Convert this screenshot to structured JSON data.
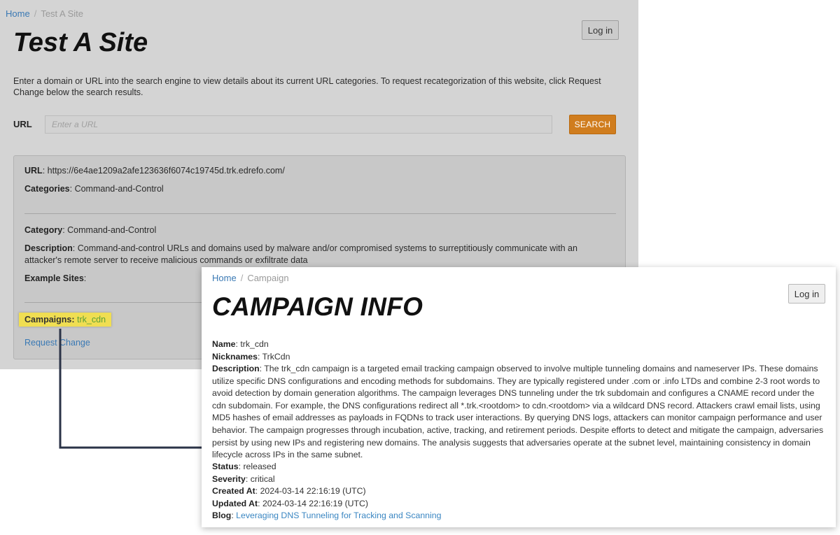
{
  "background_page": {
    "breadcrumb": {
      "home": "Home",
      "separator": "/",
      "current": "Test A Site"
    },
    "login_label": "Log in",
    "title": "Test A Site",
    "intro": "Enter a domain or URL into the search engine to view details about its current URL categories. To request recategorization of this website, click Request Change below the search results.",
    "url_label": "URL",
    "url_placeholder": "Enter a URL",
    "search_label": "SEARCH",
    "result": {
      "url_label": "URL",
      "url_value": "https://6e4ae1209a2afe123636f6074c19745d.trk.edrefo.com/",
      "categories_label": "Categories",
      "categories_value": "Command-and-Control",
      "category_label": "Category",
      "category_value": "Command-and-Control",
      "description_label": "Description",
      "description_value": "Command-and-control URLs and domains used by malware and/or compromised systems to surreptitiously communicate with an attacker's remote server to receive malicious commands or exfiltrate data",
      "example_sites_label": "Example Sites",
      "campaigns_label": "Campaigns",
      "campaigns_value": "trk_cdn",
      "request_change": "Request Change"
    }
  },
  "campaign_page": {
    "breadcrumb": {
      "home": "Home",
      "separator": "/",
      "current": "Campaign"
    },
    "login_label": "Log in",
    "title": "CAMPAIGN INFO",
    "fields": {
      "name_label": "Name",
      "name_value": "trk_cdn",
      "nicknames_label": "Nicknames",
      "nicknames_value": "TrkCdn",
      "description_label": "Description",
      "description_value": "The trk_cdn campaign is a targeted email tracking campaign observed to involve multiple tunneling domains and nameserver IPs. These domains utilize specific DNS configurations and encoding methods for subdomains. They are typically registered under .com or .info LTDs and combine 2-3 root words to avoid detection by domain generation algorithms. The campaign leverages DNS tunneling under the trk subdomain and configures a CNAME record under the cdn subdomain. For example, the DNS configurations redirect all *.trk.<rootdom> to cdn.<rootdom> via a wildcard DNS record. Attackers crawl email lists, using MD5 hashes of email addresses as payloads in FQDNs to track user interactions. By querying DNS logs, attackers can monitor campaign performance and user behavior. The campaign progresses through incubation, active, tracking, and retirement periods. Despite efforts to detect and mitigate the campaign, adversaries persist by using new IPs and registering new domains. The analysis suggests that adversaries operate at the subnet level, maintaining consistency in domain lifecycle across IPs in the same subnet.",
      "status_label": "Status",
      "status_value": "released",
      "severity_label": "Severity",
      "severity_value": "critical",
      "created_label": "Created At",
      "created_value": "2024-03-14 22:16:19 (UTC)",
      "updated_label": "Updated At",
      "updated_value": "2024-03-14 22:16:19 (UTC)",
      "blog_label": "Blog",
      "blog_value": "Leveraging DNS Tunneling for Tracking and Scanning"
    }
  },
  "colors": {
    "search_button": "#d07d1e",
    "link": "#3a79b4",
    "highlight": "#f0de52",
    "campaign_link": "#5a9f38",
    "connector": "#2b3347"
  }
}
